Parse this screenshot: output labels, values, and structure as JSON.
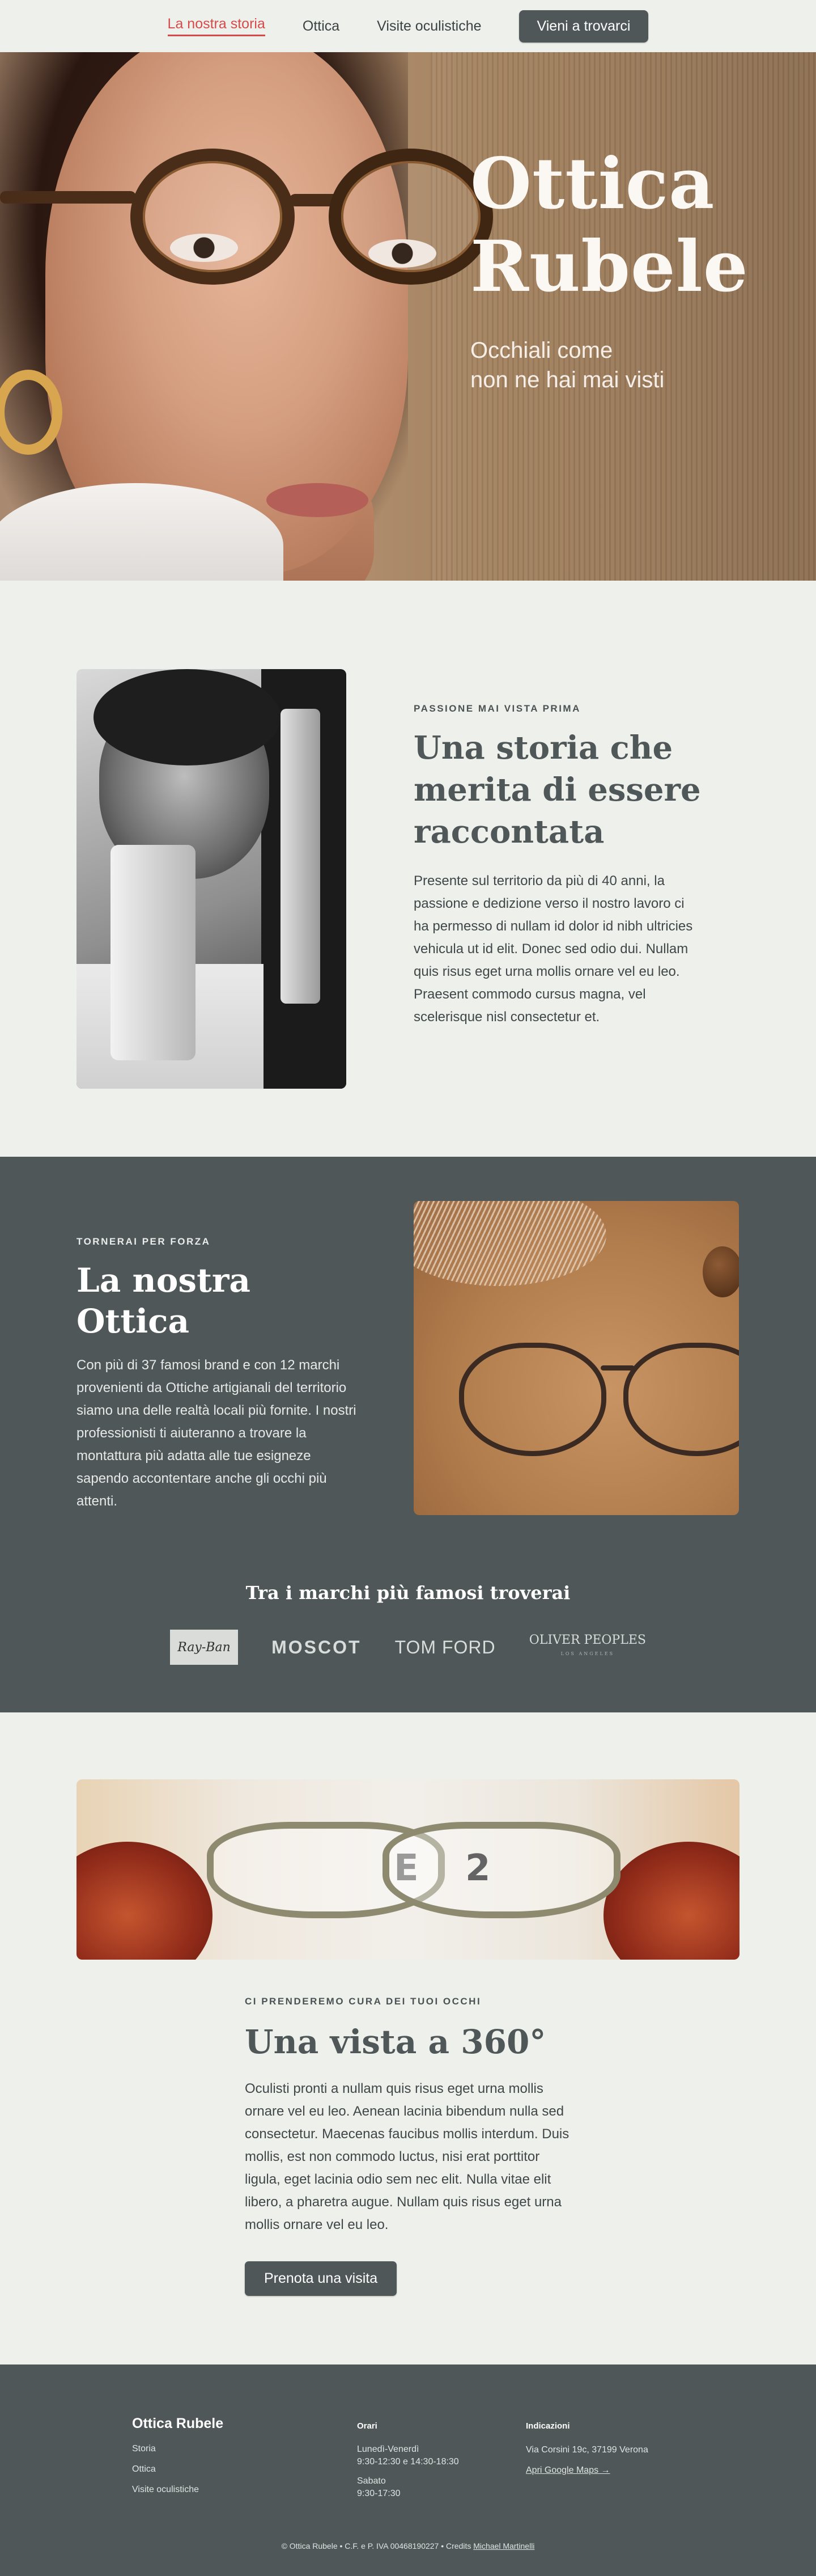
{
  "nav": {
    "items": [
      "La nostra storia",
      "Ottica",
      "Visite oculistiche"
    ],
    "cta": "Vieni a trovarci"
  },
  "hero": {
    "title_line1": "Ottica",
    "title_line2": "Rubele",
    "subtitle_line1": "Occhiali come",
    "subtitle_line2": "non ne hai mai visti"
  },
  "story": {
    "kicker": "Passione mai vista prima",
    "title": "Una storia che merita di essere raccontata",
    "text": "Presente sul territorio da più di 40 anni, la passione e dedizione verso il nostro lavoro ci ha permesso di nullam id dolor id nibh ultricies vehicula ut id elit. Donec sed odio dui. Nullam quis risus eget urna mollis ornare vel eu leo. Praesent commodo cursus magna, vel scelerisque nisl consectetur et."
  },
  "ottica": {
    "kicker": "Tornerai per forza",
    "title": "La nostra Ottica",
    "text": "Con più di 37 famosi brand e con 12 marchi provenienti da Ottiche artigianali del territorio siamo una delle realtà locali più fornite. I nostri professionisti ti aiuteranno a trovare la montattura più adatta alle tue esigneze sapendo accontentare anche gli occhi più attenti.",
    "brands_title": "Tra i marchi più famosi troverai",
    "brands": {
      "rayban": "Ray-Ban",
      "moscot": "MOSCOT",
      "tomford": "TOM FORD",
      "oliver": "OLIVER PEOPLES",
      "oliver_sub": "LOS ANGELES"
    }
  },
  "vision": {
    "kicker": "Ci prenderemo cura dei tuoi occhi",
    "title": "Una vista a 360°",
    "text": "Oculisti pronti a nullam quis risus eget urna mollis ornare vel eu leo. Aenean lacinia bibendum nulla sed consectetur. Maecenas faucibus mollis interdum. Duis mollis, est non commodo luctus, nisi erat porttitor ligula, eget lacinia odio sem nec elit. Nulla vitae elit libero, a pharetra augue. Nullam quis risus eget urna mollis ornare vel eu leo.",
    "button": "Prenota una visita"
  },
  "footer": {
    "brand": "Ottica Rubele",
    "links": [
      "Storia",
      "Ottica",
      "Visite oculistiche"
    ],
    "hours_title": "Orari",
    "hours_weekdays": "Lunedì-Venerdì",
    "hours_weekdays_time": "9:30-12:30 e 14:30-18:30",
    "hours_saturday": "Sabato",
    "hours_saturday_time": "9:30-17:30",
    "directions_title": "Indicazioni",
    "address": "Via Corsini 19c, 37199 Verona",
    "maps_link": "Apri Google Maps →",
    "copyright": "© Ottica Rubele • C.F. e P. IVA 00468190227 • Credits",
    "credits_name": "Michael Martinelli"
  },
  "colors": {
    "dark_band": "#4f5758",
    "accent_red": "#d64a4a",
    "page_bg": "#eef0eb"
  }
}
